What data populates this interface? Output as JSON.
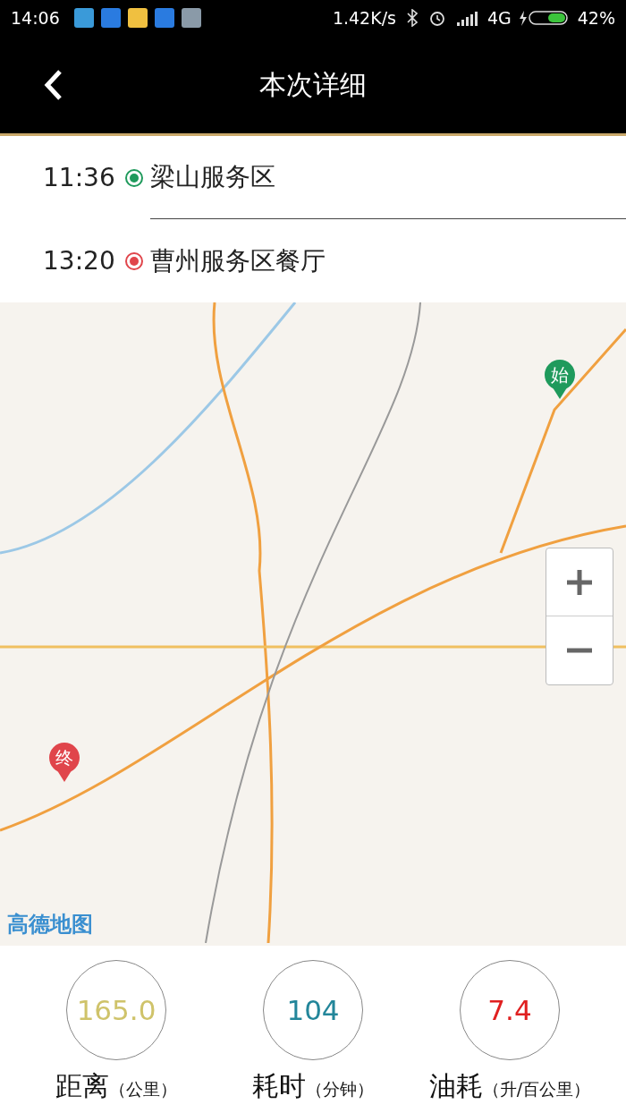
{
  "status_bar": {
    "time": "14:06",
    "speed": "1.42K/s",
    "network": "4G",
    "battery": "42%"
  },
  "header": {
    "title": "本次详细"
  },
  "route": [
    {
      "time": "11:36",
      "place": "梁山服务区",
      "kind": "start"
    },
    {
      "time": "13:20",
      "place": "曹州服务区餐厅",
      "kind": "end"
    }
  ],
  "map": {
    "start_marker": "始",
    "end_marker": "终",
    "logo": "高德地图"
  },
  "stats": [
    {
      "value": "165.0",
      "label": "距离",
      "unit": "（公里）",
      "color": "#cfc36a"
    },
    {
      "value": "104",
      "label": "耗时",
      "unit": "（分钟）",
      "color": "#23869a"
    },
    {
      "value": "7.4",
      "label": "油耗",
      "unit": "（升/百公里）",
      "color": "#e02020"
    }
  ]
}
